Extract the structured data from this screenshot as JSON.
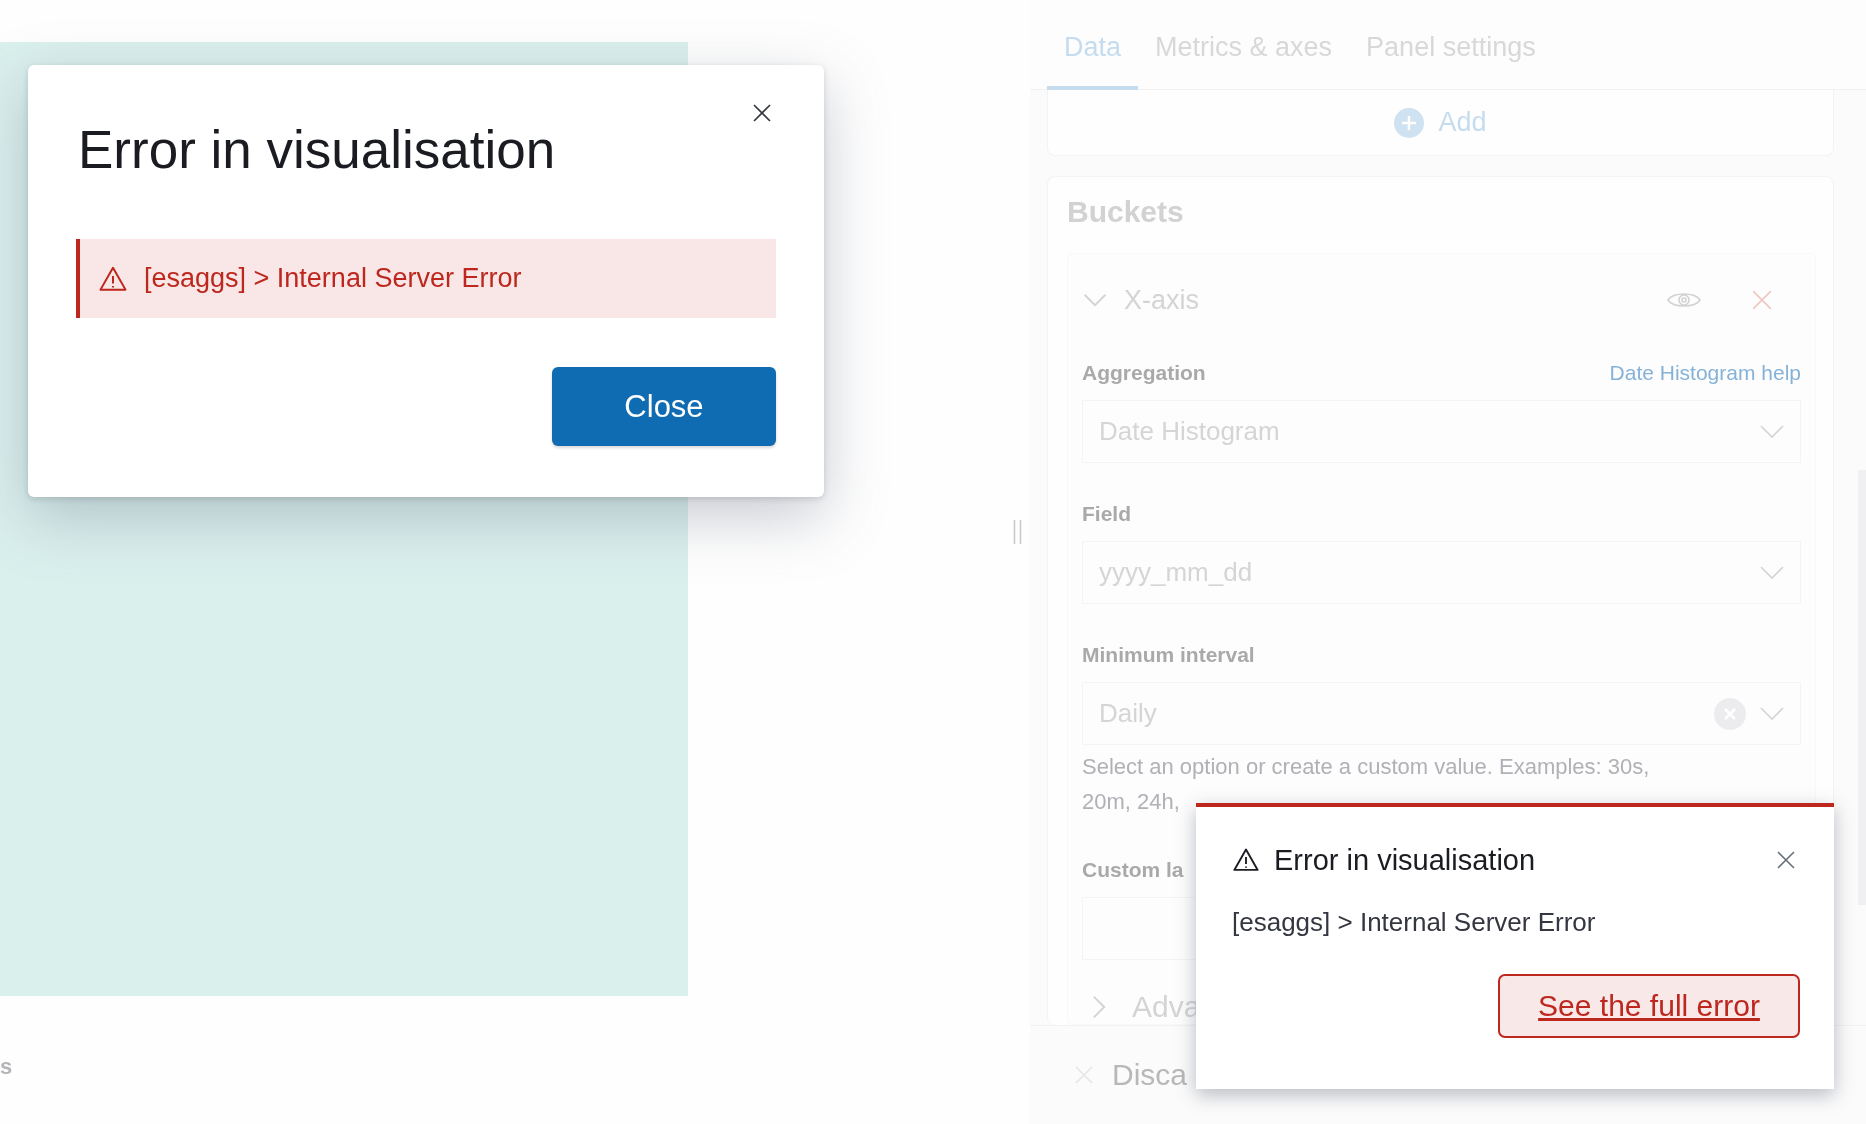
{
  "chart_area_note": "s",
  "modal": {
    "title": "Error in visualisation",
    "message": "[esaggs] > Internal Server Error",
    "button": "Close"
  },
  "panel": {
    "tabs": [
      {
        "label": "Data",
        "selected": true
      },
      {
        "label": "Metrics & axes",
        "selected": false
      },
      {
        "label": "Panel settings",
        "selected": false
      }
    ],
    "add_button": "Add",
    "buckets": {
      "title": "Buckets",
      "aggregation": {
        "title": "X-axis",
        "expanded": true
      },
      "fields": [
        {
          "kind": "select",
          "label": "Aggregation",
          "help_link": "Date Histogram help",
          "value": "Date Histogram"
        },
        {
          "kind": "select",
          "label": "Field",
          "value": "yyyy_mm_dd"
        },
        {
          "kind": "combo",
          "label": "Minimum interval",
          "value": "Daily",
          "help": "Select an option or create a custom value. Examples: 30s, 20m, 24h,"
        },
        {
          "kind": "text",
          "label": "Custom la"
        }
      ],
      "advanced": {
        "label": "Adva",
        "expanded": false
      }
    },
    "discard": "Disca"
  },
  "toast": {
    "title": "Error in visualisation",
    "message": "[esaggs] > Internal Server Error",
    "button": "See the full error"
  }
}
